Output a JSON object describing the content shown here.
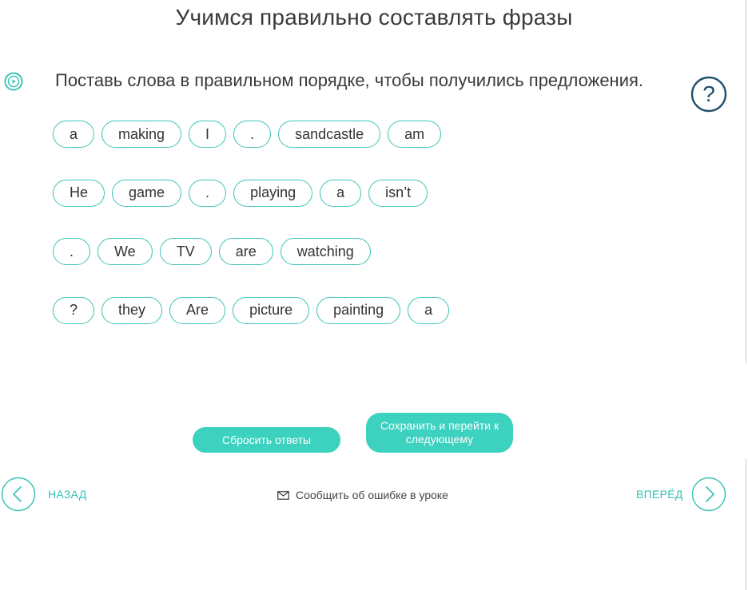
{
  "colors": {
    "accent": "#3cc4b6",
    "button": "#3dd1bf",
    "help": "#1f4e6b",
    "text": "#333333"
  },
  "header": {
    "title": "Учимся правильно составлять фразы"
  },
  "task": {
    "play_icon": "play-circle-icon",
    "instruction": "Поставь слова в правильном порядке, чтобы получились предложения.",
    "help_icon": "question-circle-icon"
  },
  "rows": [
    [
      "a",
      "making",
      "I",
      ".",
      "sandcastle",
      "am"
    ],
    [
      "He",
      "game",
      ".",
      "playing",
      "a",
      "isn’t"
    ],
    [
      ".",
      "We",
      "TV",
      "are",
      "watching"
    ],
    [
      "?",
      "they",
      "Are",
      "picture",
      "painting",
      "a"
    ]
  ],
  "actions": {
    "reset_label": "Сбросить ответы",
    "save_label": "Сохранить и перейти к следующему"
  },
  "footer": {
    "prev_label": "НАЗАД",
    "next_label": "ВПЕРЁД",
    "report_label": "Сообщить об ошибке в уроке",
    "report_icon": "mail-icon",
    "prev_icon": "chevron-left-icon",
    "next_icon": "chevron-right-icon"
  }
}
